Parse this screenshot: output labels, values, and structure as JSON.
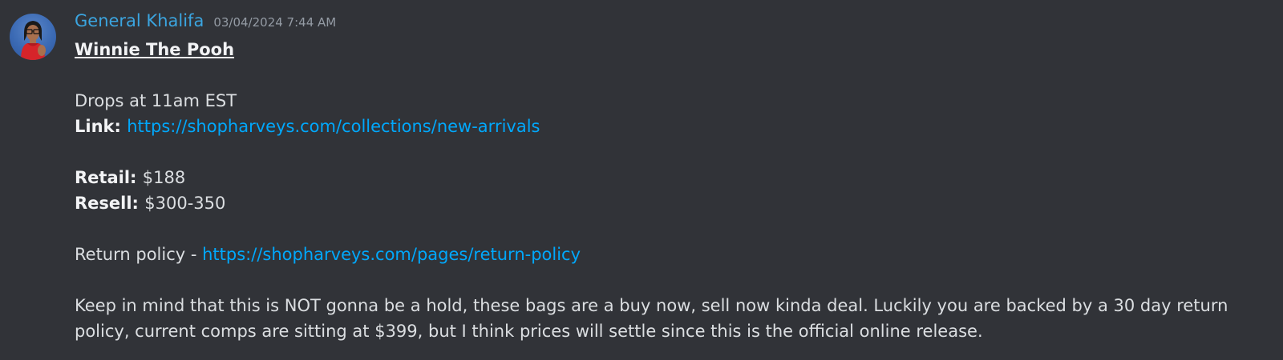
{
  "author": {
    "name": "General Khalifa",
    "timestamp": "03/04/2024 7:44 AM"
  },
  "message": {
    "title": "Winnie The Pooh",
    "drop_time": "Drops at 11am EST",
    "link_label": "Link:",
    "link_url": "https://shopharveys.com/collections/new-arrivals",
    "retail_label": "Retail:",
    "retail_value": "$188",
    "resell_label": "Resell:",
    "resell_value": "$300-350",
    "return_prefix": "Return policy - ",
    "return_url": "https://shopharveys.com/pages/return-policy",
    "note": "Keep in mind that this is NOT gonna be a hold, these bags are a buy now, sell now kinda deal. Luckily you are backed by a 30 day return policy, current comps are sitting at $399, but I think prices will settle since this is the official online release."
  },
  "colors": {
    "background": "#313338",
    "username": "#3ba5e0",
    "link": "#00a8fc",
    "text": "#dbdee1",
    "timestamp": "#949ba4"
  }
}
